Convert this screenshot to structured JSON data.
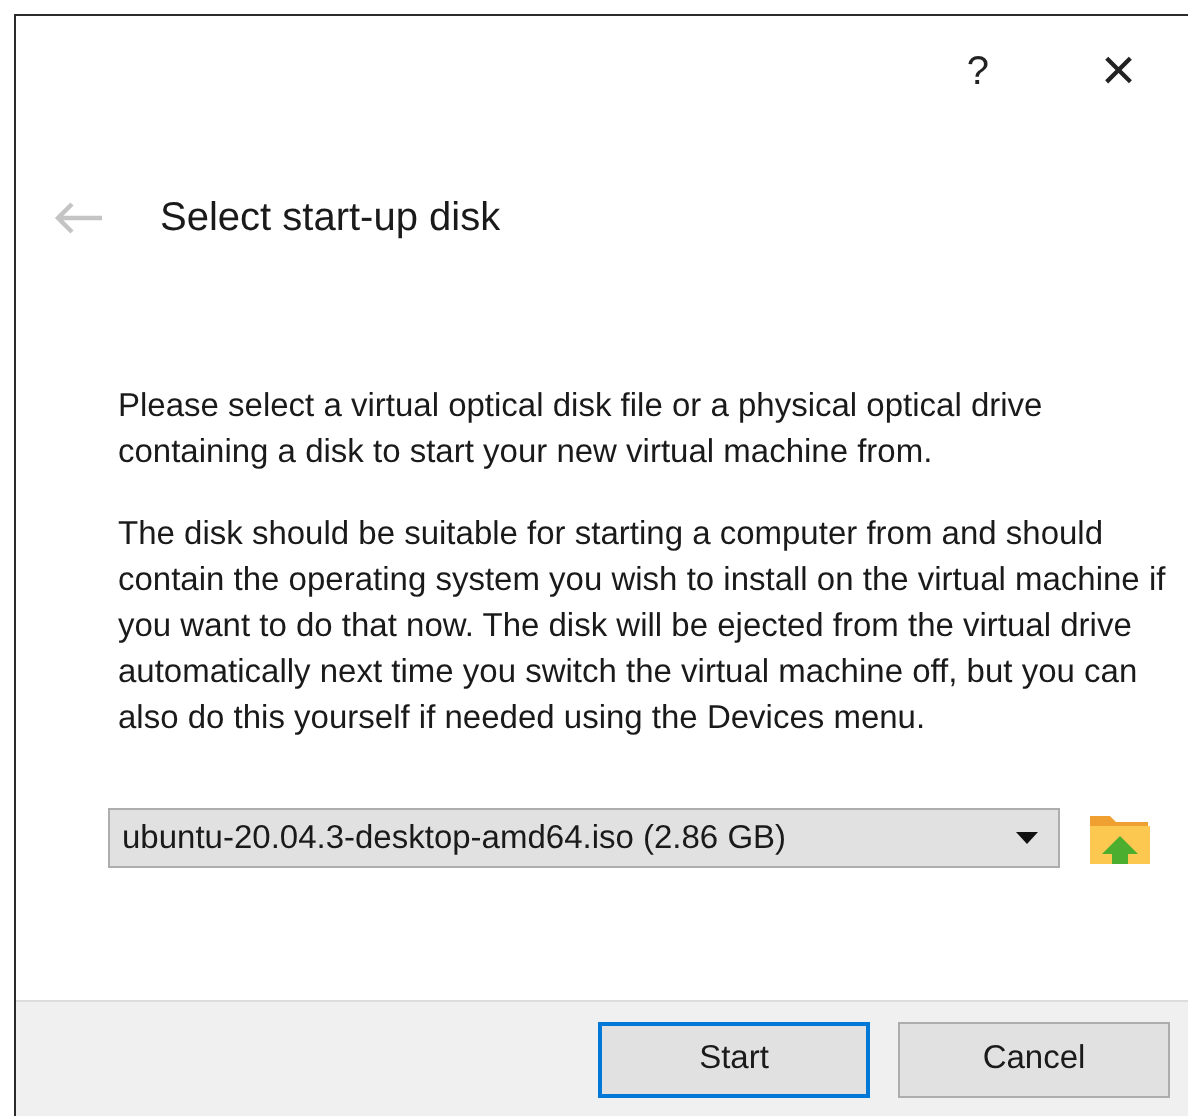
{
  "title_bar": {
    "help": "?",
    "close": "×"
  },
  "header": {
    "title": "Select start-up disk",
    "back_enabled": false
  },
  "paragraphs": [
    "Please select a virtual optical disk file or a physical optical drive containing a disk to start your new virtual machine from.",
    "The disk should be suitable for starting a computer from and should contain the operating system you wish to install on the virtual machine if you want to do that now. The disk will be ejected from the virtual drive automatically next time you switch the virtual machine off, but you can also do this yourself if needed using the Devices menu."
  ],
  "disk_select": {
    "value": "ubuntu-20.04.3-desktop-amd64.iso (2.86 GB)"
  },
  "buttons": [
    {
      "label": "Start",
      "focused": true
    },
    {
      "label": "Cancel",
      "focused": false
    }
  ]
}
